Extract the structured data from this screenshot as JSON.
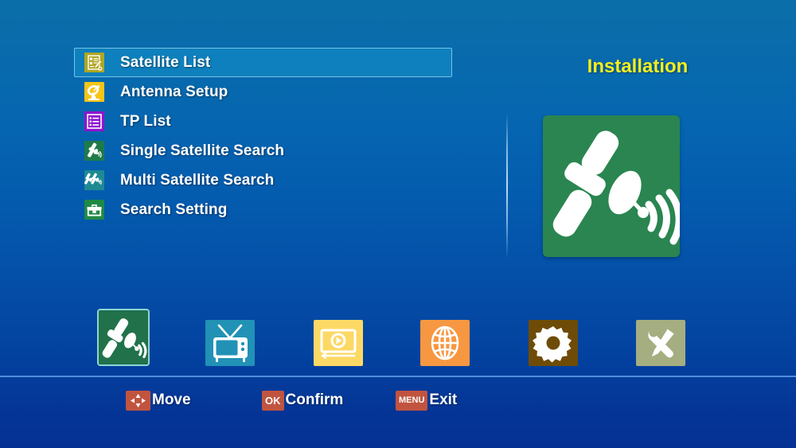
{
  "screen": {
    "panel_title": "Installation",
    "panel_art_icon": "satellite-dish-icon",
    "background_top_color": "#0a6fa8",
    "background_bottom_color": "#053194",
    "title_color": "#f2ef1f",
    "selection_fill_color": "#0e80bd",
    "selection_border_color": "#76c2e8",
    "divider_color": "#4e8fdc"
  },
  "menu": {
    "selected_index": 0,
    "items": [
      {
        "label": "Satellite List",
        "icon": "satellite-list-icon",
        "icon_bg": "#b0a623",
        "selected": true
      },
      {
        "label": "Antenna Setup",
        "icon": "antenna-dish-icon",
        "icon_bg": "#f5c518",
        "selected": false
      },
      {
        "label": "TP List",
        "icon": "tp-list-icon",
        "icon_bg": "#8e14cf",
        "selected": false
      },
      {
        "label": "Single Satellite Search",
        "icon": "single-satellite-icon",
        "icon_bg": "#1f7a4a",
        "selected": false
      },
      {
        "label": "Multi Satellite Search",
        "icon": "multi-satellite-icon",
        "icon_bg": "#1f8a93",
        "selected": false
      },
      {
        "label": "Search Setting",
        "icon": "toolbox-icon",
        "icon_bg": "#1f8a45",
        "selected": false
      }
    ]
  },
  "tabbar": {
    "active_index": 0,
    "tabs": [
      {
        "name": "installation-tab",
        "icon": "satellite-icon",
        "bg": "#21724a",
        "active": true
      },
      {
        "name": "channel-tab",
        "icon": "television-icon",
        "bg": "#2192b5",
        "active": false
      },
      {
        "name": "media-tab",
        "icon": "media-player-icon",
        "bg": "#fcd965",
        "active": false
      },
      {
        "name": "network-tab",
        "icon": "globe-icon",
        "bg": "#f79741",
        "active": false
      },
      {
        "name": "settings-tab",
        "icon": "gear-icon",
        "bg": "#6e4c07",
        "active": false
      },
      {
        "name": "tools-tab",
        "icon": "wrench-screwdriver-icon",
        "bg": "#a5ae80",
        "active": false
      }
    ]
  },
  "statusbar": {
    "hints": [
      {
        "key": "dpad",
        "key_label": "",
        "label": "Move",
        "icon": "dpad-icon"
      },
      {
        "key": "ok",
        "key_label": "OK",
        "label": "Confirm",
        "icon": "ok-key-icon"
      },
      {
        "key": "menu",
        "key_label": "MENU",
        "label": "Exit",
        "icon": "menu-key-icon"
      }
    ],
    "key_color": "#c1543f"
  }
}
